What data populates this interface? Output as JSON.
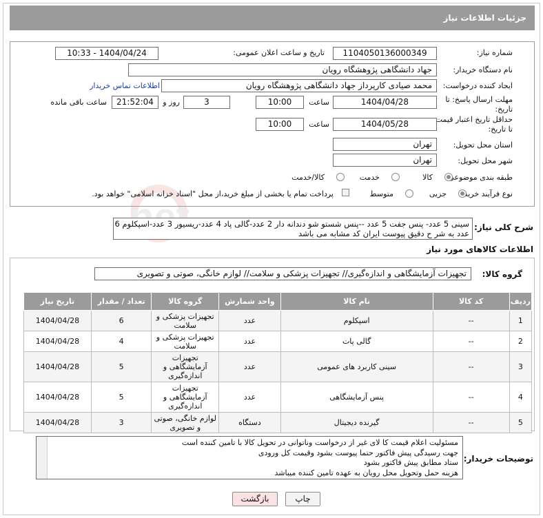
{
  "header": {
    "title": "جزئیات اطلاعات نیاز"
  },
  "form": {
    "need_number_label": "شماره نیاز:",
    "need_number": "1104050136000349",
    "announce_datetime_label": "تاریخ و ساعت اعلان عمومی:",
    "announce_datetime": "1404/04/24 - 10:33",
    "buyer_org_label": "نام دستگاه خریدار:",
    "buyer_org": "جهاد دانشگاهی پژوهشگاه رویان",
    "requester_label": "ایجاد کننده درخواست:",
    "requester": "محمد صیادی کارپرداز جهاد دانشگاهی پژوهشگاه رویان",
    "buyer_contact_link": "اطلاعات تماس خریدار",
    "reply_deadline_label_1": "مهلت ارسال پاسخ: تا",
    "reply_deadline_label_2": "تاریخ:",
    "reply_date": "1404/04/28",
    "time_label": "ساعت",
    "reply_time": "10:00",
    "days_value": "3",
    "days_label": "روز و",
    "remaining_time": "21:52:04",
    "remaining_label": "ساعت باقی مانده",
    "price_validity_label_1": "حداقل تاریخ اعتبار قیمت:",
    "price_validity_label_2": "تا تاریخ:",
    "validity_date": "1404/05/28",
    "validity_time": "10:00",
    "delivery_province_label": "استان محل تحویل:",
    "delivery_province": "تهران",
    "delivery_city_label": "شهر محل تحویل:",
    "delivery_city": "تهران",
    "category_label": "طبقه بندی موضوعی:",
    "category_options": [
      "کالا",
      "خدمت",
      "کالا/خدمت"
    ],
    "category_selected": "کالا",
    "purchase_type_label": "نوع فرآیند خرید :",
    "purchase_type_options": [
      "جزیی",
      "متوسط"
    ],
    "purchase_type_selected": "جزیی",
    "payment_note": "پرداخت تمام یا بخشی از مبلغ خرید،از محل \"اسناد خزانه اسلامی\" خواهد بود."
  },
  "description": {
    "label": "شرح کلی نیاز:",
    "text_line1": "سینی 5 عدد- پنس جفت 5 عدد --پنس شستو شو دندانه دار 2 عدد-گالی پاد 4 عدد-ریسیور 3 عدد-اسپکلوم 6",
    "text_line2": "عدد به شر ح دقیق پیوست ایران کد مشابه می باشد"
  },
  "goods": {
    "section_title": "اطلاعات کالاهای مورد نیاز",
    "group_label": "گروه کالا:",
    "group_value": "تجهیزات آزمایشگاهی و اندازه‌گیری// تجهیزات پزشکی و سلامت// لوازم خانگی، صوتی و تصویری",
    "columns": [
      "ردیف",
      "کد کالا",
      "نام کالا",
      "واحد شمارش",
      "گروه کالا",
      "تعداد / مقدار",
      "تاریخ نیاز"
    ],
    "rows": [
      {
        "row": "1",
        "code": "--",
        "name": "اسپکلوم",
        "unit": "عدد",
        "group": "تجهیزات پزشکی و سلامت",
        "qty": "6",
        "date": "1404/04/28"
      },
      {
        "row": "2",
        "code": "--",
        "name": "گالی پات",
        "unit": "عدد",
        "group": "تجهیزات پزشکی و سلامت",
        "qty": "4",
        "date": "1404/04/28"
      },
      {
        "row": "3",
        "code": "--",
        "name": "سینی کاربرد های عمومی",
        "unit": "عدد",
        "group": "تجهیزات آزمایشگاهی و اندازه‌گیری",
        "qty": "5",
        "date": "1404/04/28"
      },
      {
        "row": "4",
        "code": "--",
        "name": "پنس آزمایشگاهی",
        "unit": "عدد",
        "group": "تجهیزات آزمایشگاهی و اندازه‌گیری",
        "qty": "5",
        "date": "1404/04/28"
      },
      {
        "row": "5",
        "code": "--",
        "name": "گیرنده دیجیتال",
        "unit": "دستگاه",
        "group": "لوازم خانگی، صوتی و تصویری",
        "qty": "3",
        "date": "1404/04/28"
      }
    ]
  },
  "buyer_notes": {
    "label": "توضیحات خریدار:",
    "lines": [
      "مسئولیت اعلام قیمت کا لای  غیر از درخواست وناتوانی در تحویل کالا با تامین کننده است",
      "جهت رسیدگی پیش فاکتور حتما پیوست بشود وقیمت کل ورودی",
      "ستاد مطابق پیش فاکتور بشود",
      "هزینه حمل وتحویل محل رویان به عهده تامین کننده میباشد"
    ]
  },
  "actions": {
    "print_label": "چاپ",
    "back_label": "بازگشت"
  },
  "watermark": {
    "text": "AriaTender.net"
  }
}
